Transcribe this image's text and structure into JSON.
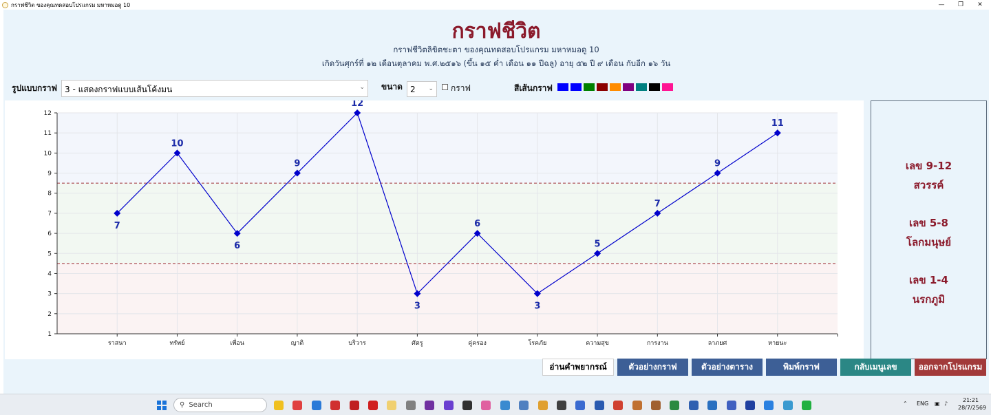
{
  "window": {
    "title": "กราฟชีวิต ของคุณทดสอบโปรแกรม มหาหมอดู 10"
  },
  "header": {
    "title": "กราฟชีวิต",
    "subtitle": "กราฟชีวิตลิขิตชะตา ของคุณทดสอบโปรแกรม มหาหมอดู 10",
    "birth_info": "เกิดวันศุกร์ที่ ๑๒ เดือนตุลาคม  พ.ศ.๒๕๑๖ (ขึ้น ๑๕ ค่ำ  เดือน ๑๑ ปีฉลู)  อายุ ๕๒  ปี ๙ เดือน กับอีก ๑๖ วัน"
  },
  "controls": {
    "style_label": "รูปแบบกราฟ",
    "style_value": "3 - แสดงกราฟแบบเส้นโค้งมน",
    "size_label": "ขนาด",
    "size_value": "2",
    "graph_checkbox_label": "กราฟ",
    "color_label": "สีเส้นกราฟ",
    "colors": [
      "#0000ff",
      "#0000ff",
      "#008000",
      "#8b0000",
      "#ff8c00",
      "#800080",
      "#008080",
      "#000000",
      "#ff1493"
    ]
  },
  "chart_data": {
    "type": "line",
    "categories": [
      "ราสนา",
      "ทรัพย์",
      "เพื่อน",
      "ญาติ",
      "บริวาร",
      "ศัตรู",
      "คู่ครอง",
      "โรคภัย",
      "ความสุข",
      "การงาน",
      "ลาภยศ",
      "หายนะ"
    ],
    "values": [
      7,
      10,
      6,
      9,
      12,
      3,
      6,
      3,
      5,
      7,
      9,
      11
    ],
    "data_labels": [
      "7",
      "10",
      "6",
      "9",
      "12",
      "3",
      "6",
      "3",
      "5",
      "7",
      "9",
      "11"
    ],
    "yticks": [
      "1",
      "2",
      "3",
      "4",
      "5",
      "6",
      "7",
      "8",
      "9",
      "10",
      "11",
      "12"
    ],
    "ylim": [
      1,
      12
    ],
    "threshold_lines": [
      8.5,
      4.5
    ],
    "bands": [
      {
        "from": 8.5,
        "to": 12,
        "color": "#f3f6fc"
      },
      {
        "from": 4.5,
        "to": 8.5,
        "color": "#f2f8f2"
      },
      {
        "from": 1,
        "to": 4.5,
        "color": "#fbf3f3"
      }
    ],
    "line_color": "#0000cc",
    "threshold_color": "#a0303a",
    "grid": true
  },
  "legend": {
    "heaven_range": "เลข 9-12",
    "heaven": "สวรรค์",
    "human_range": "เลข 5-8",
    "human": "โลกมนุษย์",
    "hell_range": "เลข 1-4",
    "hell": "นรกภูมิ"
  },
  "buttons": {
    "read": "อ่านคำพยากรณ์",
    "sample_graph": "ตัวอย่างกราฟ",
    "sample_table": "ตัวอย่างตาราง",
    "print": "พิมพ์กราฟ",
    "back": "กลับเมนูเลข",
    "exit": "ออกจากโปรแกรม"
  },
  "taskbar": {
    "search_placeholder": "Search",
    "lang": "ENG",
    "time": "21:21",
    "date": "28/7/2569"
  }
}
